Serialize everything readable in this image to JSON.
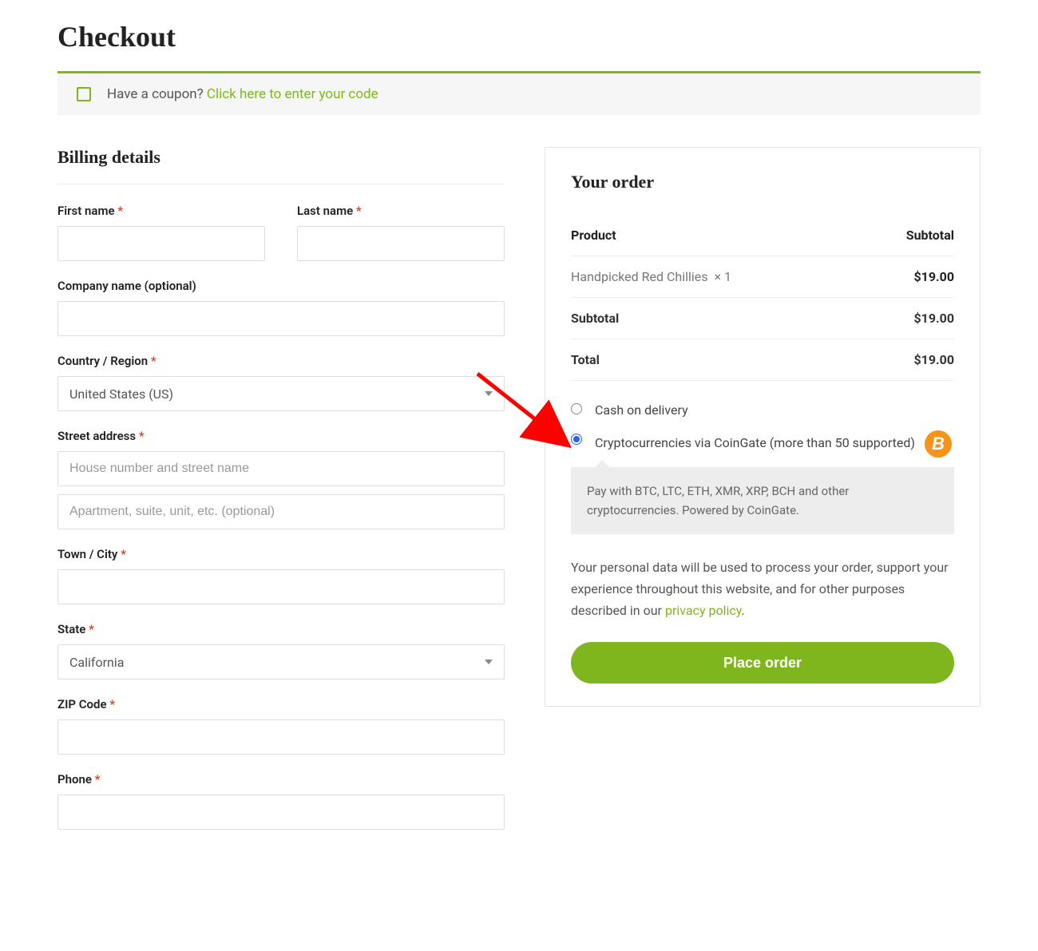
{
  "page": {
    "title": "Checkout"
  },
  "coupon": {
    "prompt": "Have a coupon? ",
    "link_text": "Click here to enter your code"
  },
  "billing": {
    "heading": "Billing details",
    "first_name": {
      "label": "First name",
      "required": true,
      "value": ""
    },
    "last_name": {
      "label": "Last name",
      "required": true,
      "value": ""
    },
    "company": {
      "label": "Company name (optional)",
      "required": false,
      "value": ""
    },
    "country": {
      "label": "Country / Region",
      "required": true,
      "selected": "United States (US)"
    },
    "street": {
      "label": "Street address",
      "required": true,
      "line1_placeholder": "House number and street name",
      "line1_value": "",
      "line2_placeholder": "Apartment, suite, unit, etc. (optional)",
      "line2_value": ""
    },
    "city": {
      "label": "Town / City",
      "required": true,
      "value": ""
    },
    "state": {
      "label": "State",
      "required": true,
      "selected": "California"
    },
    "zip": {
      "label": "ZIP Code",
      "required": true,
      "value": ""
    },
    "phone": {
      "label": "Phone",
      "required": true,
      "value": ""
    }
  },
  "order": {
    "heading": "Your order",
    "columns": {
      "product": "Product",
      "subtotal": "Subtotal"
    },
    "items": [
      {
        "name": "Handpicked Red Chillies",
        "qty_text": "× 1",
        "price": "$19.00"
      }
    ],
    "subtotal_label": "Subtotal",
    "subtotal_value": "$19.00",
    "total_label": "Total",
    "total_value": "$19.00"
  },
  "payments": {
    "cod": {
      "label": "Cash on delivery",
      "selected": false
    },
    "crypto": {
      "label": "Cryptocurrencies via CoinGate (more than 50 supported)",
      "selected": true,
      "icon": "bitcoin-icon",
      "description": "Pay with BTC, LTC, ETH, XMR, XRP, BCH and other cryptocurrencies. Powered by CoinGate."
    }
  },
  "privacy": {
    "text_before": "Your personal data will be used to process your order, support your experience throughout this website, and for other purposes described in our ",
    "link_text": "privacy policy",
    "text_after": "."
  },
  "actions": {
    "place_order": "Place order"
  },
  "colors": {
    "accent": "#7fb51d",
    "bitcoin": "#f7931a",
    "required": "#e2401c"
  }
}
